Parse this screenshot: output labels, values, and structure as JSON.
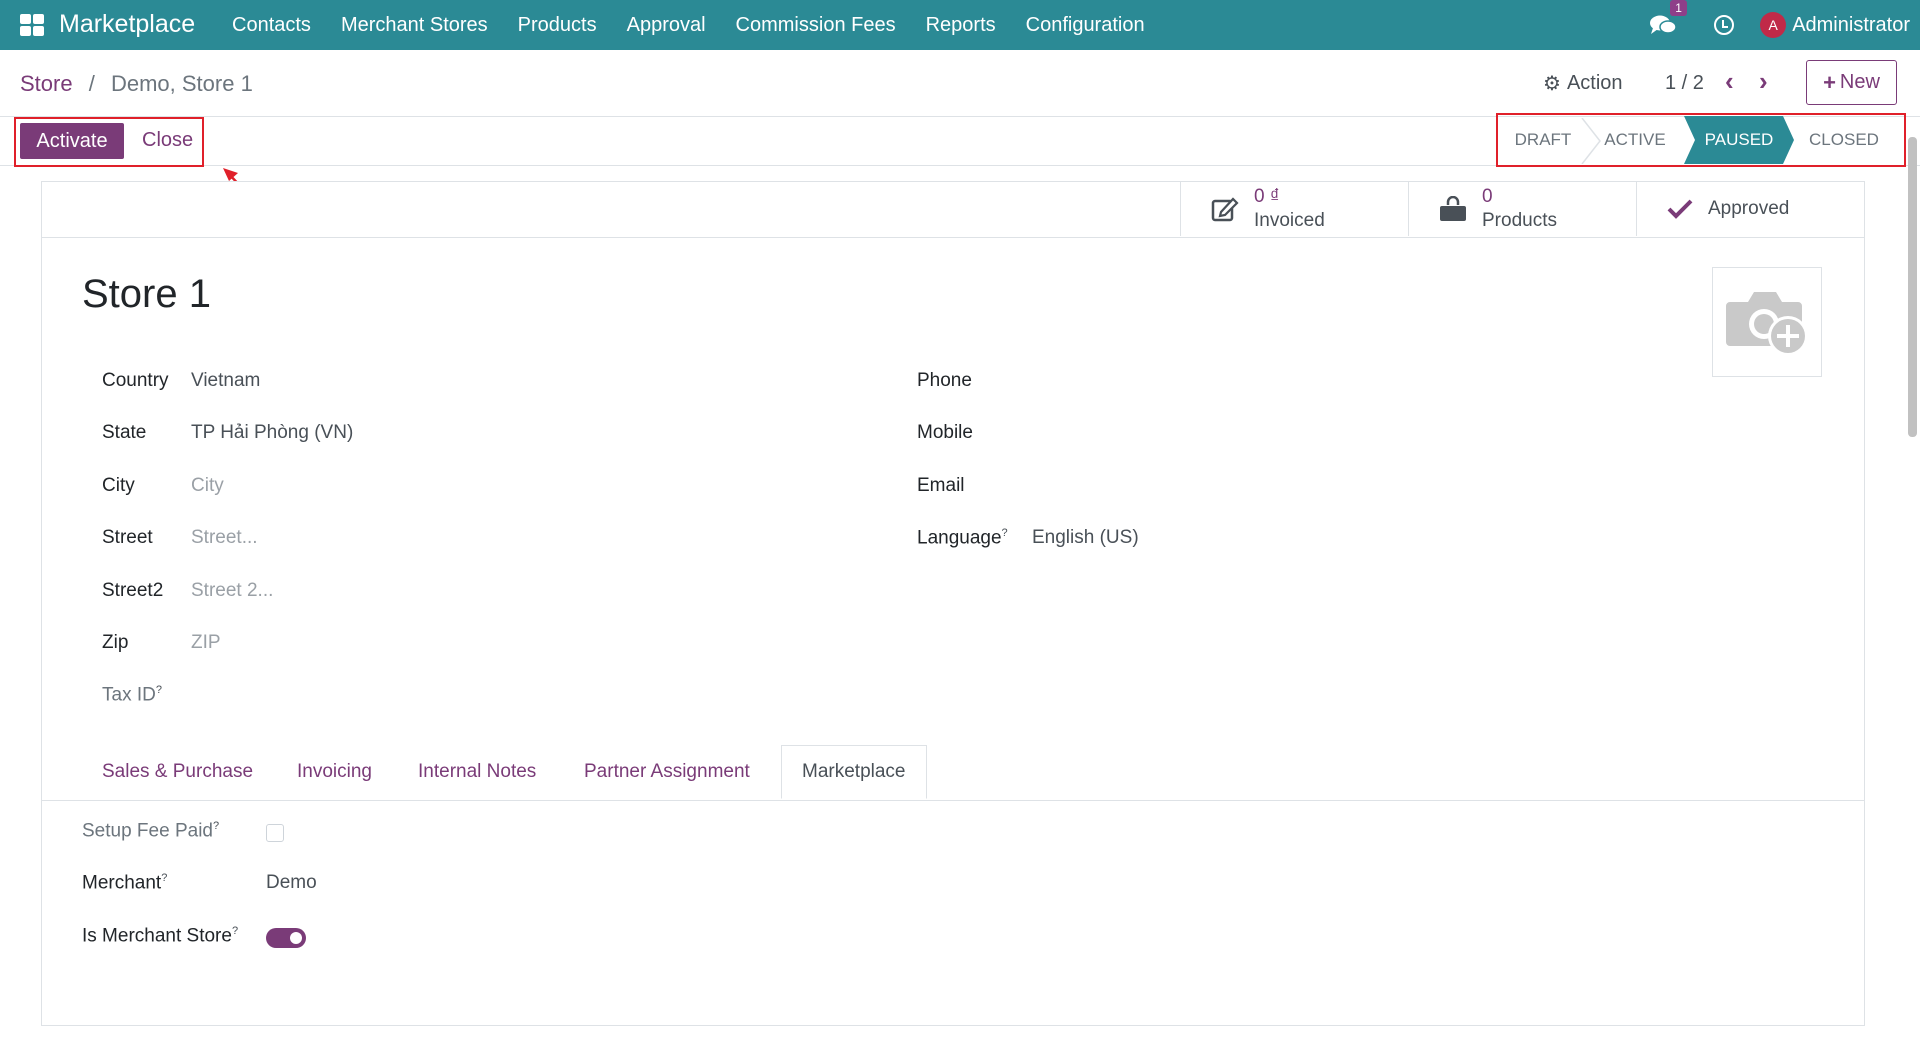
{
  "navbar": {
    "brand": "Marketplace",
    "menu": [
      "Contacts",
      "Merchant Stores",
      "Products",
      "Approval",
      "Commission Fees",
      "Reports",
      "Configuration"
    ],
    "chat_badge": "1",
    "avatar_letter": "A",
    "username": "Administrator",
    "bg_color": "#2b8a95"
  },
  "breadcrumb": {
    "parent": "Store",
    "separator": "/",
    "current": "Demo, Store 1"
  },
  "control": {
    "action_label": "Action",
    "pager": "1 / 2",
    "new_label": "New"
  },
  "statusbar": {
    "buttons": {
      "activate": "Activate",
      "close": "Close"
    },
    "stages": [
      "DRAFT",
      "ACTIVE",
      "PAUSED",
      "CLOSED"
    ],
    "current_stage": "PAUSED"
  },
  "smart_buttons": {
    "invoiced": {
      "value": "0 ₫",
      "label": "Invoiced"
    },
    "products": {
      "value": "0",
      "label": "Products"
    },
    "approved": {
      "label": "Approved"
    }
  },
  "record": {
    "title": "Store 1",
    "left_fields": [
      {
        "label": "Country",
        "value": "Vietnam",
        "placeholder": false
      },
      {
        "label": "State",
        "value": "TP Hải Phòng (VN)",
        "placeholder": false
      },
      {
        "label": "City",
        "value": "City",
        "placeholder": true
      },
      {
        "label": "Street",
        "value": "Street...",
        "placeholder": true
      },
      {
        "label": "Street2",
        "value": "Street 2...",
        "placeholder": true
      },
      {
        "label": "Zip",
        "value": "ZIP",
        "placeholder": true
      },
      {
        "label": "Tax ID",
        "value": "",
        "placeholder": true
      }
    ],
    "right_fields": [
      {
        "label": "Phone",
        "value": ""
      },
      {
        "label": "Mobile",
        "value": ""
      },
      {
        "label": "Email",
        "value": ""
      },
      {
        "label": "Language",
        "value": "English (US)"
      }
    ]
  },
  "tabs": [
    "Sales & Purchase",
    "Invoicing",
    "Internal Notes",
    "Partner Assignment",
    "Marketplace"
  ],
  "active_tab": "Marketplace",
  "marketplace_tab": {
    "setup_fee_paid": {
      "label": "Setup Fee Paid",
      "checked": false
    },
    "merchant": {
      "label": "Merchant",
      "value": "Demo"
    },
    "is_merchant_store": {
      "label": "Is Merchant Store",
      "on": true
    }
  },
  "help_marker": "?"
}
